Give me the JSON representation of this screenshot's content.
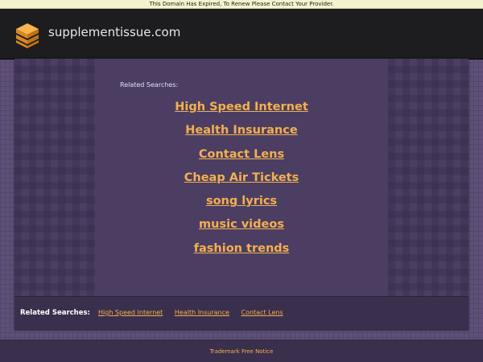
{
  "notice_bar": {
    "text": "This Domain Has Expired, To Renew Please Contact Your Provider."
  },
  "header": {
    "logo_icon": "stacked-layers-icon",
    "domain": "supplementissue.com"
  },
  "main": {
    "related_label": "Related Searches:",
    "links": [
      "High Speed Internet",
      "Health Insurance",
      "Contact Lens",
      "Cheap Air Tickets",
      "song lyrics",
      "music videos",
      "fashion trends"
    ]
  },
  "footer": {
    "label": "Related Searches:",
    "links": [
      "High Speed Internet",
      "Health Insurance",
      "Contact Lens"
    ]
  },
  "bottom": {
    "trademark": "Trademark Free Notice"
  },
  "colors": {
    "accent_link": "#f3b04d",
    "panel": "#4c3e63",
    "header": "#1d1d1f"
  }
}
